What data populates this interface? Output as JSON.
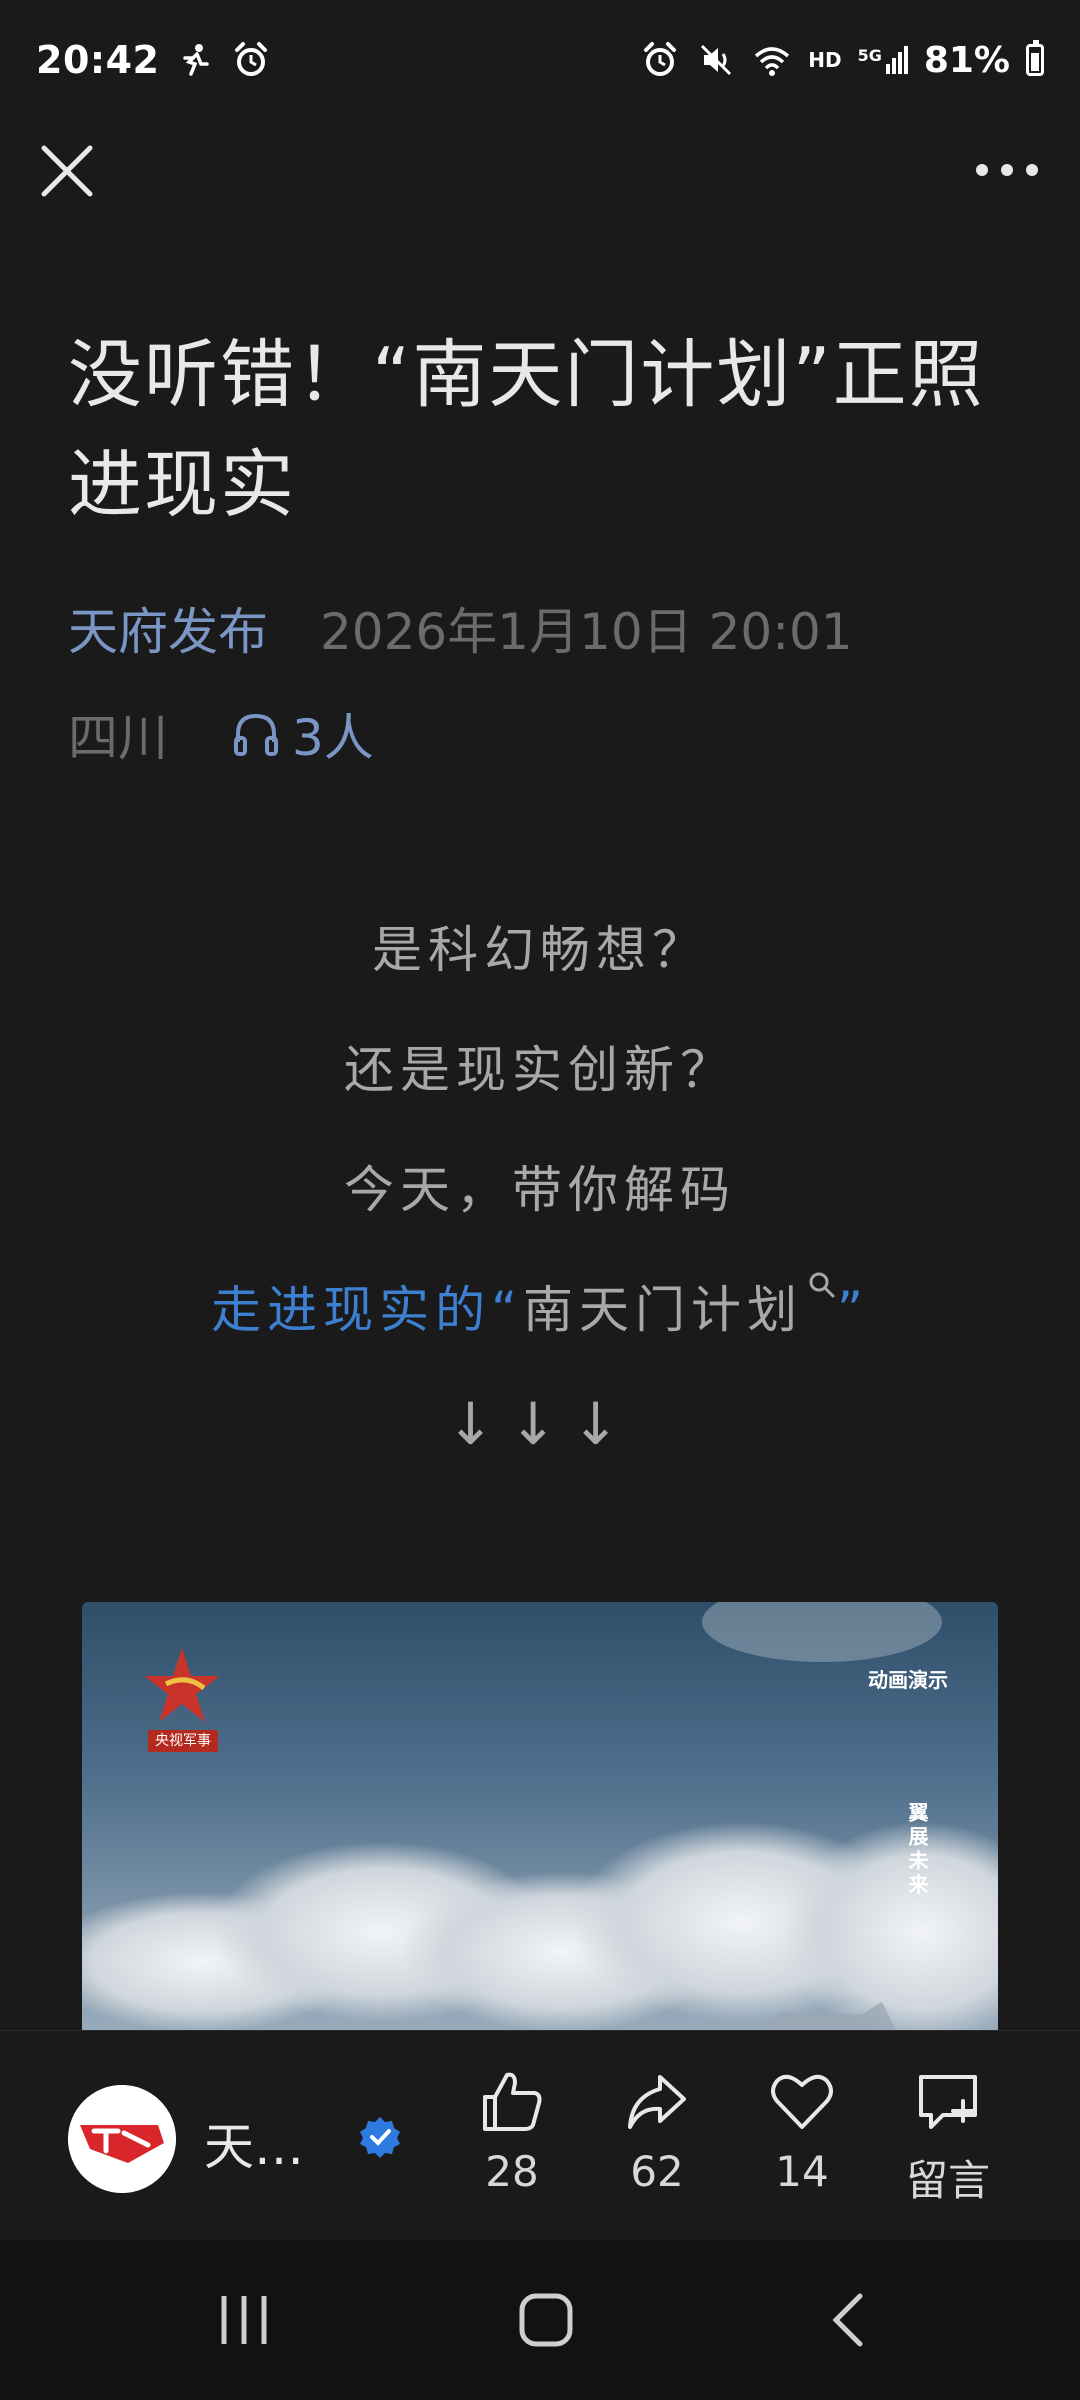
{
  "status_bar": {
    "time": "20:42",
    "network": "HD",
    "signal": "5G",
    "battery": "81%",
    "battery_level": 0.81
  },
  "article": {
    "title": "没听错！“南天门计划”正照进现实",
    "author_link": "天府发布",
    "published": "2026年1月10日 20:01",
    "region": "四川",
    "listeners": "3人",
    "body": {
      "line1": "是科幻畅想？",
      "line2": "还是现实创新？",
      "line3": "今天，带你解码",
      "line4_prefix": "走进现实的“",
      "line4_term": "南天门计划",
      "line4_suffix": "”",
      "arrows": "↓↓↓"
    },
    "video": {
      "channel_label": "央视军事",
      "tag": "动画演示",
      "vertical_text": "翼展未来"
    }
  },
  "action_bar": {
    "author_name": "天…",
    "likes": "28",
    "shares": "62",
    "favorites": "14",
    "comment_label": "留言"
  },
  "colors": {
    "background": "#1a1a1a",
    "link": "#3d7fd0",
    "author_link": "#7a96c4",
    "verified": "#2d7be0"
  },
  "icons": {
    "close": "close-icon",
    "more": "more-icon",
    "headphones": "headphones-icon",
    "search": "search-icon",
    "like": "thumbs-up-icon",
    "share": "share-icon",
    "favorite": "heart-icon",
    "comment": "comment-icon",
    "verified": "verified-badge-icon"
  }
}
